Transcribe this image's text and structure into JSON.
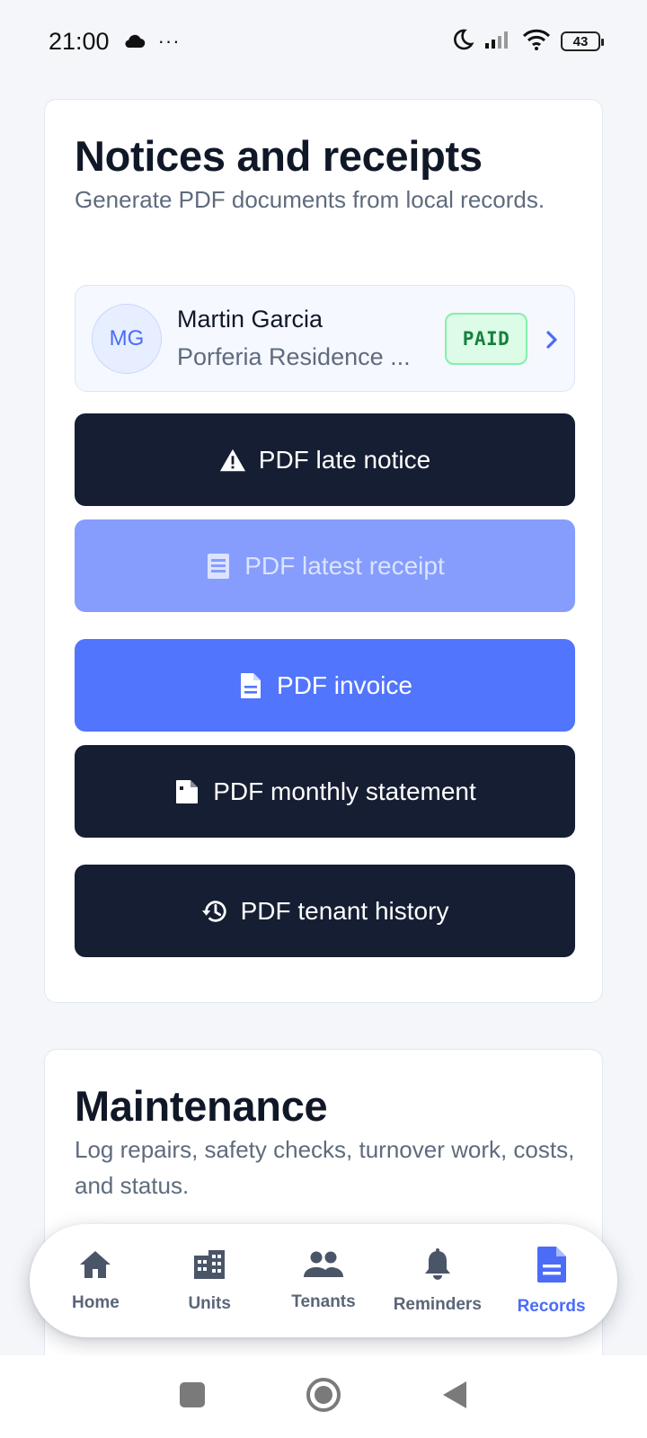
{
  "status_bar": {
    "time": "21:00",
    "dots": "···",
    "battery": "43"
  },
  "notices": {
    "title": "Notices and receipts",
    "subtitle": "Generate PDF documents from local records.",
    "tenant": {
      "initials": "MG",
      "name": "Martin Garcia",
      "property": "Porferia Residence ...",
      "status": "PAID"
    },
    "buttons": [
      {
        "label": "PDF late notice",
        "icon": "warning-icon"
      },
      {
        "label": "PDF latest receipt",
        "icon": "receipt-icon"
      },
      {
        "label": "PDF invoice",
        "icon": "document-icon"
      },
      {
        "label": "PDF monthly statement",
        "icon": "file-icon"
      },
      {
        "label": "PDF tenant history",
        "icon": "history-icon"
      }
    ]
  },
  "maintenance": {
    "title": "Maintenance",
    "subtitle": "Log repairs, safety checks, turnover work, costs, and status."
  },
  "nav": {
    "items": [
      {
        "label": "Home",
        "icon": "home-icon"
      },
      {
        "label": "Units",
        "icon": "building-icon"
      },
      {
        "label": "Tenants",
        "icon": "people-icon"
      },
      {
        "label": "Reminders",
        "icon": "bell-icon"
      },
      {
        "label": "Records",
        "icon": "records-icon"
      }
    ],
    "active": "Records"
  },
  "colors": {
    "accent": "#4a6cf7",
    "dark_button": "#151e32",
    "paid_green": "#15803d"
  }
}
